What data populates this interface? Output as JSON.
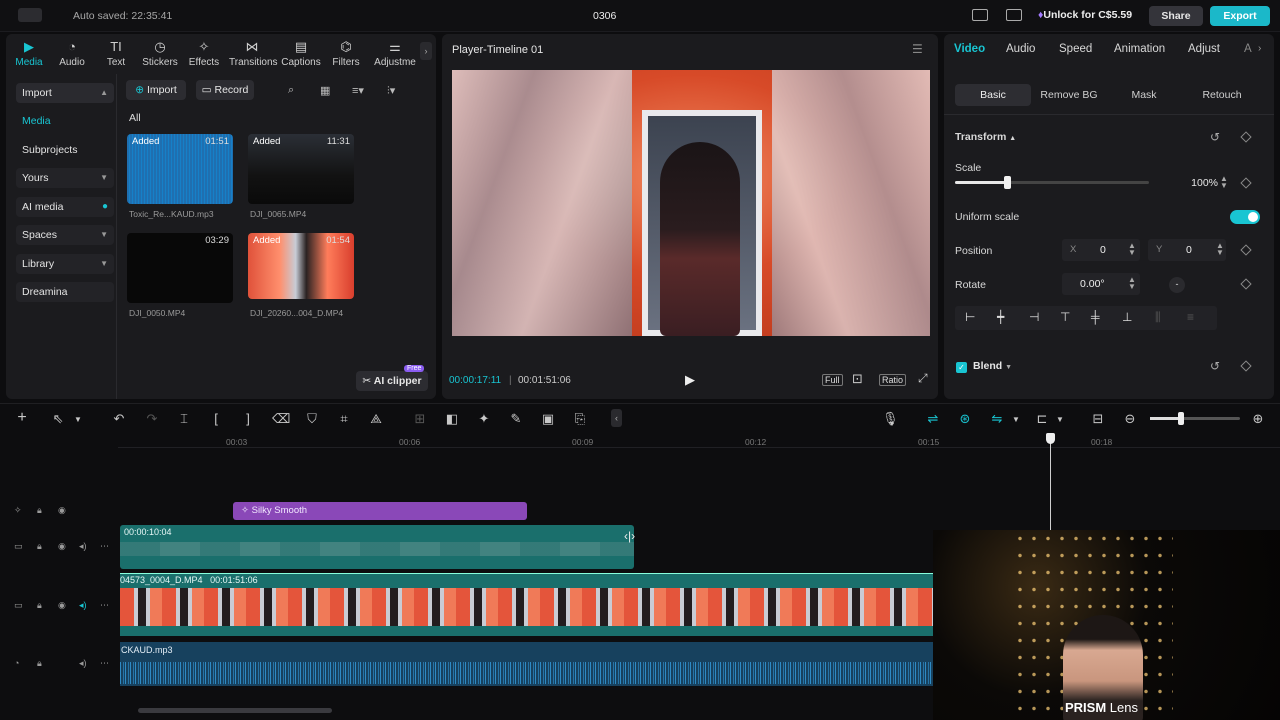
{
  "app": {
    "autosave": "Auto saved: 22:35:41",
    "project": "0306",
    "unlock": "Unlock for C$5.59",
    "share": "Share",
    "export": "Export"
  },
  "toolbar": {
    "items": [
      {
        "label": "Media",
        "icon": "media-icon"
      },
      {
        "label": "Audio",
        "icon": "audio-icon"
      },
      {
        "label": "Text",
        "icon": "text-icon"
      },
      {
        "label": "Stickers",
        "icon": "stickers-icon"
      },
      {
        "label": "Effects",
        "icon": "effects-icon"
      },
      {
        "label": "Transitions",
        "icon": "transitions-icon"
      },
      {
        "label": "Captions",
        "icon": "captions-icon"
      },
      {
        "label": "Filters",
        "icon": "filters-icon"
      },
      {
        "label": "Adjustme",
        "icon": "adjustment-icon"
      }
    ]
  },
  "sidebar": {
    "items": [
      "Import",
      "Media",
      "Subprojects",
      "Yours",
      "AI media",
      "Spaces",
      "Library",
      "Dreamina"
    ]
  },
  "media": {
    "import_label": "Import",
    "record_label": "Record",
    "filter_all": "All",
    "clips": [
      {
        "name": "Toxic_Re...KAUD.mp3",
        "duration": "01:51",
        "added": "Added"
      },
      {
        "name": "DJI_0065.MP4",
        "duration": "11:31",
        "added": "Added"
      },
      {
        "name": "DJI_0050.MP4",
        "duration": "03:29",
        "added": ""
      },
      {
        "name": "DJI_20260...004_D.MP4",
        "duration": "01:54",
        "added": "Added"
      }
    ],
    "ai_clipper": "AI clipper",
    "free_badge": "Free"
  },
  "player": {
    "title": "Player-Timeline 01",
    "current_time": "00:00:17:11",
    "total_time": "00:01:51:06",
    "full": "Full",
    "ratio": "Ratio"
  },
  "inspector": {
    "tabs": [
      "Video",
      "Audio",
      "Speed",
      "Animation",
      "Adjust",
      "A"
    ],
    "subtabs": [
      "Basic",
      "Remove BG",
      "Mask",
      "Retouch"
    ],
    "transform": "Transform",
    "scale_label": "Scale",
    "scale_value": "100%",
    "scale_fraction": 0.27,
    "uniform_scale": "Uniform scale",
    "uniform_on": true,
    "position_label": "Position",
    "pos_x_label": "X",
    "pos_x": "0",
    "pos_y_label": "Y",
    "pos_y": "0",
    "rotate_label": "Rotate",
    "rotate_value": "0.00°",
    "blend": "Blend"
  },
  "timeline": {
    "ticks": [
      "00:03",
      "00:06",
      "00:09",
      "00:12",
      "00:15",
      "00:18"
    ],
    "effect_clip": "Silky Smooth",
    "overlay_clip_time": "00:00:10:04",
    "main_clip_name": "04573_0004_D.MP4",
    "main_clip_time": "00:01:51:06",
    "audio_clip": "CKAUD.mp3"
  },
  "webcam": {
    "brand_bold": "PRISM",
    "brand_light": " Lens"
  },
  "colors": {
    "accent": "#19c5d2",
    "export": "#1bb8c9",
    "effect": "#8a48b8",
    "video_track": "#1a6f6c",
    "audio_track": "#17415e"
  }
}
